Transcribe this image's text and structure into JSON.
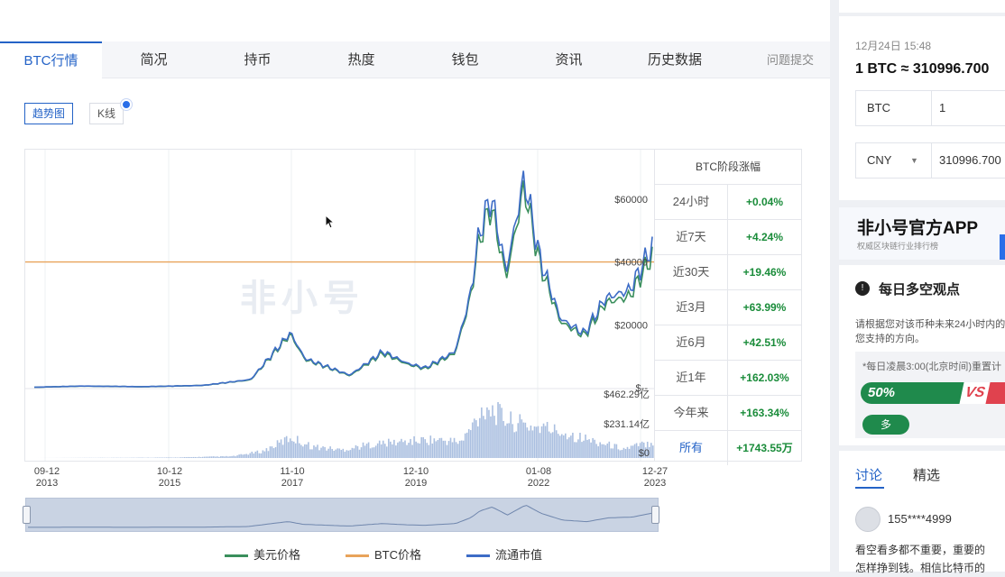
{
  "tabs": [
    "BTC行情",
    "简况",
    "持币",
    "热度",
    "钱包",
    "资讯",
    "历史数据"
  ],
  "feedback_link": "问题提交",
  "chart_buttons": {
    "trend": "趋势图",
    "kline": "K线"
  },
  "watermark": "非小号",
  "stats": {
    "title": "BTC阶段涨幅",
    "rows": [
      {
        "label": "24小时",
        "value": "+0.04%"
      },
      {
        "label": "近7天",
        "value": "+4.24%"
      },
      {
        "label": "近30天",
        "value": "+19.46%"
      },
      {
        "label": "近3月",
        "value": "+63.99%"
      },
      {
        "label": "近6月",
        "value": "+42.51%"
      },
      {
        "label": "近1年",
        "value": "+162.03%"
      },
      {
        "label": "今年来",
        "value": "+163.34%"
      },
      {
        "label": "所有",
        "value": "+1743.55万"
      }
    ]
  },
  "chart_data": {
    "type": "line",
    "x_ticks": [
      {
        "day": "09-12",
        "year": "2013"
      },
      {
        "day": "10-12",
        "year": "2015"
      },
      {
        "day": "11-10",
        "year": "2017"
      },
      {
        "day": "12-10",
        "year": "2019"
      },
      {
        "day": "01-08",
        "year": "2022"
      },
      {
        "day": "12-27",
        "year": "2023"
      }
    ],
    "price_ticks": [
      "$60000",
      "$40000",
      "$20000",
      "$--"
    ],
    "volume_ticks": [
      "$462.29亿",
      "$231.14亿",
      "$0"
    ],
    "ylim_price": [
      0,
      70000
    ],
    "ylim_volume": [
      0,
      46229000000
    ],
    "reference_line_value": 40000,
    "series": [
      {
        "name": "美元价格",
        "color": "#3a8f5c",
        "x": [
          2013.7,
          2014.5,
          2015.5,
          2016.5,
          2017.3,
          2017.96,
          2018.2,
          2018.5,
          2018.95,
          2019.5,
          2019.9,
          2020.2,
          2020.7,
          2020.95,
          2021.1,
          2021.3,
          2021.55,
          2021.85,
          2022.1,
          2022.45,
          2022.85,
          2023.2,
          2023.6,
          2023.98
        ],
        "values": [
          130,
          500,
          300,
          700,
          2500,
          17000,
          9000,
          7000,
          3800,
          11000,
          7500,
          6000,
          11000,
          28000,
          47000,
          58000,
          35000,
          64000,
          40000,
          21000,
          16500,
          27000,
          29000,
          42000
        ]
      },
      {
        "name": "BTC价格",
        "color": "#e8a35a",
        "x": [
          2013.7,
          2023.98
        ],
        "values": [
          40000,
          40000
        ]
      },
      {
        "name": "流通市值",
        "color": "#3d6cc6",
        "x": [
          2013.7,
          2014.5,
          2015.5,
          2016.5,
          2017.3,
          2017.96,
          2018.2,
          2018.5,
          2018.95,
          2019.5,
          2019.9,
          2020.2,
          2020.7,
          2020.95,
          2021.1,
          2021.3,
          2021.55,
          2021.85,
          2022.1,
          2022.45,
          2022.85,
          2023.2,
          2023.6,
          2023.98
        ],
        "values": [
          140,
          520,
          320,
          720,
          2600,
          17500,
          9300,
          7200,
          4000,
          11500,
          7800,
          6300,
          11500,
          29000,
          49000,
          61000,
          37000,
          67000,
          42000,
          22000,
          17200,
          28500,
          31000,
          45000
        ]
      }
    ],
    "volume": {
      "name": "成交额",
      "x": [
        2013.7,
        2015.0,
        2016.0,
        2017.0,
        2017.5,
        2017.96,
        2018.3,
        2018.8,
        2019.3,
        2019.8,
        2020.3,
        2020.8,
        2021.0,
        2021.2,
        2021.4,
        2021.6,
        2021.9,
        2022.2,
        2022.5,
        2022.9,
        2023.2,
        2023.5,
        2023.98
      ],
      "values": [
        0,
        200000000,
        400000000,
        1500000000,
        6000000000,
        18000000000,
        10000000000,
        7000000000,
        12000000000,
        14000000000,
        16000000000,
        14000000000,
        30000000000,
        46000000000,
        38000000000,
        32000000000,
        28000000000,
        26000000000,
        22000000000,
        16000000000,
        12000000000,
        8000000000,
        14000000000
      ]
    }
  },
  "legend": [
    "美元价格",
    "BTC价格",
    "流通市值"
  ],
  "converter": {
    "time": "12月24日 15:48",
    "rate": "1 BTC ≈ 310996.700",
    "from_currency": "BTC",
    "from_value": "1",
    "to_currency": "CNY",
    "to_value": "310996.700"
  },
  "app_promo": {
    "title": "非小号官方APP",
    "subtitle": "权威区块链行业排行榜"
  },
  "sentiment": {
    "title": "每日多空观点",
    "desc_line1": "请根据您对该币种未来24小时内的",
    "desc_line2": "您支持的方向。",
    "note": "*每日凌晨3:00(北京时间)重置计",
    "bull_percent": "50%",
    "bull_fraction": 0.5,
    "vs": "VS",
    "bull_button": "多"
  },
  "discussion": {
    "tabs": [
      "讨论",
      "精选"
    ],
    "username": "155****4999",
    "comment_line1": "看空看多都不重要，重要的",
    "comment_line2": "怎样挣到钱。相信比特币的"
  },
  "colors": {
    "accent": "#2463c7",
    "gain": "#1a8c3a",
    "usd_line": "#3a8f5c",
    "btc_line": "#e8a35a",
    "cap_line": "#3d6cc6",
    "volume_bar": "#aabfe0"
  }
}
